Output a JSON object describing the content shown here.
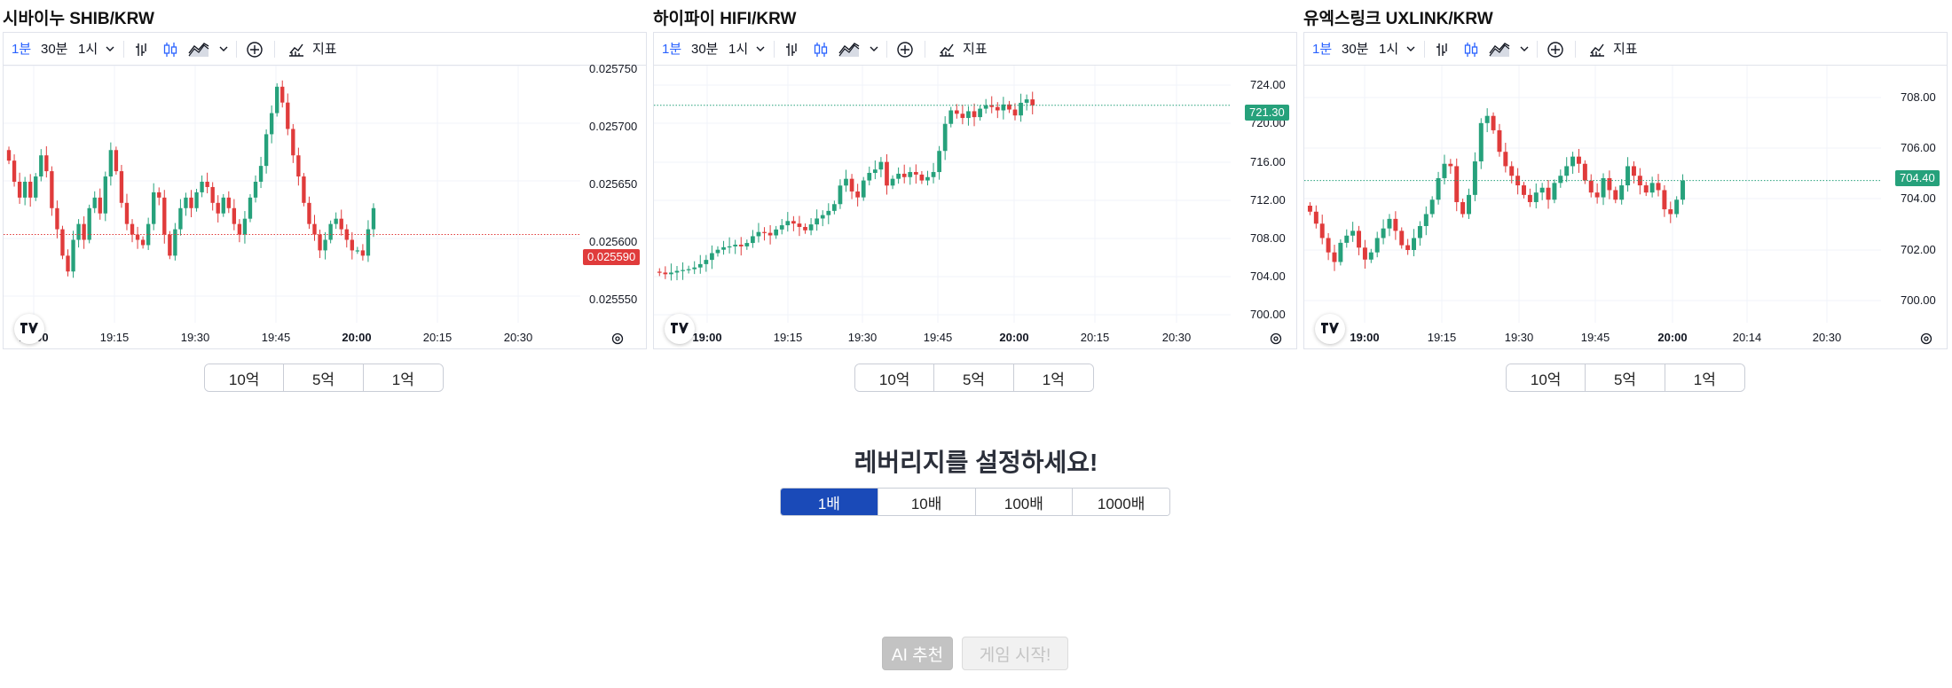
{
  "panels": [
    {
      "title": "시바이누 SHIB/KRW",
      "toolbar": {
        "tf1": "1분",
        "tf2": "30분",
        "tf3": "1시",
        "indicators": "지표"
      },
      "price_tag": {
        "value": "0.025590",
        "color": "#e03b3b"
      },
      "chart_data": {
        "type": "candlestick",
        "ylim": [
          0.02553,
          0.02575
        ],
        "y_ticks": [
          "0.025750",
          "0.025700",
          "0.025650",
          "0.025600",
          "0.025550"
        ],
        "x_ticks": [
          "19:00",
          "19:15",
          "19:30",
          "19:45",
          "20:00",
          "20:15",
          "20:30"
        ],
        "x_ticks_bold": [
          true,
          false,
          false,
          false,
          true,
          false,
          false
        ],
        "last_price": 0.02559,
        "closes": [
          0.02566,
          0.02564,
          0.025625,
          0.02564,
          0.025625,
          0.025645,
          0.025665,
          0.02565,
          0.025615,
          0.025595,
          0.02557,
          0.025555,
          0.025585,
          0.0256,
          0.025585,
          0.025615,
          0.025625,
          0.02561,
          0.025645,
          0.02567,
          0.02565,
          0.02562,
          0.0256,
          0.02559,
          0.025585,
          0.02558,
          0.0256,
          0.02563,
          0.025625,
          0.02559,
          0.02557,
          0.025595,
          0.025615,
          0.025625,
          0.025615,
          0.02563,
          0.02564,
          0.025635,
          0.02562,
          0.02561,
          0.025625,
          0.025615,
          0.0256,
          0.02559,
          0.025605,
          0.025625,
          0.02564,
          0.025655,
          0.025685,
          0.025705,
          0.02573,
          0.025715,
          0.02569,
          0.025665,
          0.025645,
          0.02562,
          0.0256,
          0.02559,
          0.025575,
          0.025585,
          0.0256,
          0.025605,
          0.025595,
          0.025585,
          0.025575,
          0.025575,
          0.02557,
          0.025595,
          0.025615
        ]
      },
      "lot_buttons": [
        "10억",
        "5억",
        "1억"
      ]
    },
    {
      "title": "하이파이 HIFI/KRW",
      "toolbar": {
        "tf1": "1분",
        "tf2": "30분",
        "tf3": "1시",
        "indicators": "지표"
      },
      "price_tag": {
        "value": "721.30",
        "color": "#26a17b"
      },
      "chart_data": {
        "type": "candlestick",
        "ylim": [
          698.5,
          726.0
        ],
        "y_ticks": [
          "724.00",
          "720.00",
          "716.00",
          "712.00",
          "708.00",
          "704.00",
          "700.00"
        ],
        "x_ticks": [
          "19:00",
          "19:15",
          "19:30",
          "19:45",
          "20:00",
          "20:15",
          "20:30"
        ],
        "x_ticks_bold": [
          true,
          false,
          false,
          false,
          true,
          false,
          false
        ],
        "last_price": 721.3,
        "closes": [
          701.5,
          701.3,
          701.5,
          701.7,
          701.8,
          701.9,
          702.1,
          702.5,
          703.0,
          703.8,
          704.2,
          704.5,
          704.6,
          704.8,
          704.6,
          705.0,
          705.8,
          706.3,
          706.2,
          705.9,
          706.6,
          707.1,
          707.6,
          707.3,
          706.9,
          706.5,
          707.2,
          707.9,
          708.3,
          708.8,
          709.6,
          711.8,
          712.6,
          711.1,
          710.4,
          712.4,
          713.3,
          713.7,
          714.6,
          711.8,
          712.6,
          713.2,
          712.8,
          713.4,
          713.1,
          712.4,
          712.8,
          713.4,
          715.9,
          719.1,
          720.7,
          720.3,
          719.8,
          720.6,
          719.9,
          720.9,
          721.3,
          721.1,
          720.7,
          721.4,
          720.8,
          720.1,
          721.6,
          722.0,
          721.3
        ]
      },
      "lot_buttons": [
        "10억",
        "5억",
        "1억"
      ]
    },
    {
      "title": "유엑스링크 UXLINK/KRW",
      "toolbar": {
        "tf1": "1분",
        "tf2": "30분",
        "tf3": "1시",
        "indicators": "지표"
      },
      "price_tag": {
        "value": "704.40",
        "color": "#26a17b"
      },
      "chart_data": {
        "type": "candlestick",
        "ylim": [
          699.5,
          709.2
        ],
        "y_ticks": [
          "708.00",
          "706.00",
          "704.00",
          "702.00",
          "700.00"
        ],
        "x_ticks": [
          "19:00",
          "19:15",
          "19:30",
          "19:45",
          "20:00",
          "20:14",
          "20:30"
        ],
        "x_ticks_bold": [
          true,
          false,
          false,
          false,
          true,
          false,
          false
        ],
        "last_price": 704.4,
        "closes": [
          703.1,
          702.6,
          702.0,
          701.4,
          701.0,
          701.8,
          702.1,
          702.3,
          701.6,
          701.1,
          701.4,
          702.0,
          702.4,
          702.8,
          702.3,
          701.7,
          701.5,
          702.0,
          702.5,
          703.0,
          703.6,
          704.5,
          705.1,
          705.0,
          703.5,
          703.0,
          703.8,
          705.2,
          706.8,
          707.1,
          706.5,
          705.6,
          705.0,
          704.6,
          704.2,
          703.8,
          703.5,
          703.9,
          704.1,
          703.6,
          704.3,
          704.6,
          705.0,
          705.4,
          705.1,
          704.4,
          703.9,
          703.7,
          704.5,
          704.0,
          703.6,
          704.2,
          705.0,
          704.6,
          704.2,
          703.9,
          704.3,
          704.0,
          703.2,
          703.0,
          703.6,
          704.4
        ]
      },
      "lot_buttons": [
        "10억",
        "5억",
        "1억"
      ]
    }
  ],
  "leverage": {
    "title": "레버리지를 설정하세요!",
    "options": [
      "1배",
      "10배",
      "100배",
      "1000배"
    ],
    "selected": "1배"
  },
  "actions": {
    "ai_label": "AI 추천",
    "start_label": "게임 시작!"
  },
  "colors": {
    "up": "#26a17b",
    "down": "#e03b3b",
    "selected": "#1a4ab8",
    "accent": "#2962ff"
  }
}
